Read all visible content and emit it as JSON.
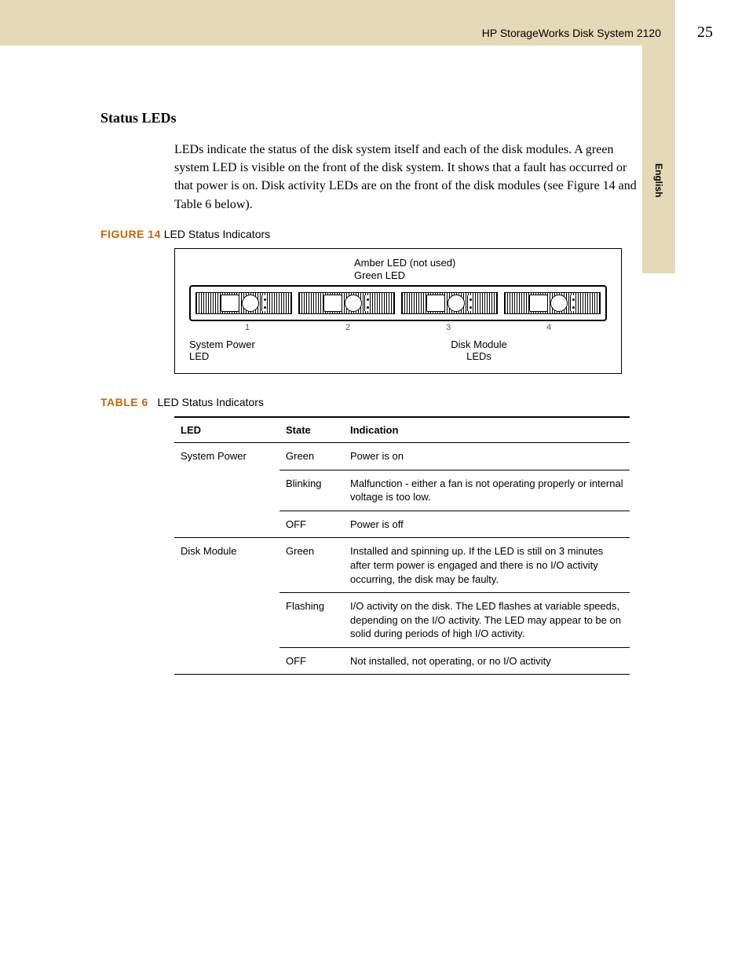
{
  "header": {
    "title": "HP  StorageWorks Disk System 2120",
    "page_number": "25"
  },
  "side_tab": "English",
  "section_heading": "Status LEDs",
  "intro_paragraph": "LEDs indicate the status of the disk system itself and each of the disk modules. A green system LED is visible on the front of the disk system. It shows that a fault has occurred or that power is on. Disk activity LEDs are on the front of the disk modules (see Figure 14 and Table 6 below).",
  "figure": {
    "label": "FIGURE 14",
    "title": "LED Status Indicators",
    "callouts": {
      "top1": "Amber LED (not used)",
      "top2": "Green LED",
      "bottom_left_1": "System Power",
      "bottom_left_2": "LED",
      "bottom_right_1": "Disk Module",
      "bottom_right_2": "LEDs"
    },
    "slot_numbers": [
      "1",
      "2",
      "3",
      "4"
    ]
  },
  "table": {
    "label": "TABLE 6",
    "title": "LED Status Indicators",
    "headers": {
      "c1": "LED",
      "c2": "State",
      "c3": "Indication"
    },
    "rows": [
      {
        "led": "System Power",
        "state": "Green",
        "ind": "Power is on"
      },
      {
        "led": "",
        "state": "Blinking",
        "ind": "Malfunction -  either a fan is not operating properly or internal voltage is too low."
      },
      {
        "led": "",
        "state": "OFF",
        "ind": "Power is off"
      },
      {
        "led": "Disk Module",
        "state": "Green",
        "ind": "Installed and spinning up. If the LED is still on 3 minutes after term power is engaged and there is no I/O activity occurring, the disk may be faulty."
      },
      {
        "led": "",
        "state": "Flashing",
        "ind": "I/O activity on the disk. The LED flashes at variable speeds, depending on the I/O activity. The LED may appear to be on solid during periods of high I/O activity."
      },
      {
        "led": "",
        "state": "OFF",
        "ind": "Not installed, not operating, or no I/O activity"
      }
    ]
  }
}
